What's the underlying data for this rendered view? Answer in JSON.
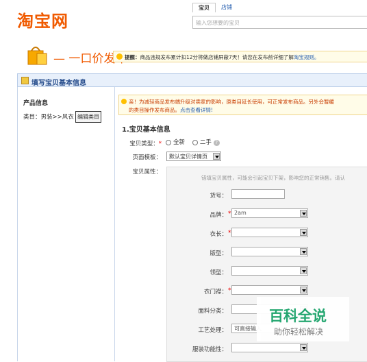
{
  "header": {
    "logo": "淘宝网",
    "search_tabs": [
      "宝贝",
      "店铺"
    ],
    "search_placeholder": "输入您想要的宝贝"
  },
  "publish": {
    "title": "一口价发布",
    "notice_bold": "提醒：",
    "notice_text": "商品违规发布累计扣12分将做店铺屏蔽7天！请您在发布前详细了解",
    "notice_link": "淘宝规则。"
  },
  "section": {
    "title": "填写宝贝基本信息"
  },
  "left": {
    "title": "产品信息",
    "category": "类目：男装>>风衣",
    "edit_button": "编辑类目"
  },
  "warning": {
    "line1": "亲！为减轻商品发布端升级对卖家的影响，原类目延长使用，可正常发布商品。另外会暂缓",
    "line2_text": "的类目操作发布商品。",
    "line2_link": "点击查看详情!"
  },
  "form": {
    "section_title": "1.宝贝基本信息",
    "type_label": "宝贝类型：",
    "type_options": [
      "全新",
      "二手"
    ],
    "template_label": "页面模板：",
    "template_value": "默认宝贝详情页",
    "attr_label": "宝贝属性：",
    "attr_hint": "错填宝贝属性，可能会引起宝贝下架，影响您的正常销售。请认",
    "fields": [
      {
        "label": "货号：",
        "value": "",
        "required": false
      },
      {
        "label": "品牌：",
        "value": "2am",
        "required": true
      },
      {
        "label": "衣长：",
        "value": "",
        "required": true
      },
      {
        "label": "版型：",
        "value": "",
        "required": false
      },
      {
        "label": "领型：",
        "value": "",
        "required": false
      },
      {
        "label": "衣门襟：",
        "value": "",
        "required": true
      },
      {
        "label": "面料分类：",
        "value": "",
        "required": false
      },
      {
        "label": "工艺处理：",
        "value": "可直接输入",
        "required": false
      },
      {
        "label": "服装功能性：",
        "value": "",
        "required": false
      }
    ]
  },
  "watermark": {
    "big": "百科全说",
    "small": "助你轻松解决"
  }
}
